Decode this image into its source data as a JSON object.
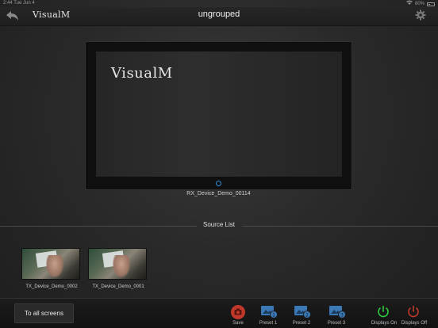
{
  "status_bar": {
    "time": "2:44",
    "date": "Tue Jun 4",
    "battery": "80%"
  },
  "header": {
    "logo": "VisualM",
    "title": "ungrouped"
  },
  "monitor": {
    "screen_logo": "VisualM",
    "label": "RX_Device_Demo_00114",
    "power_color": "#2a8fd6"
  },
  "source_list": {
    "title": "Source List",
    "items": [
      {
        "label": "TX_Device_Demo_0002"
      },
      {
        "label": "TX_Device_Demo_0001"
      }
    ]
  },
  "toolbar": {
    "all_screens_label": "To all screens",
    "save_label": "Save",
    "preset1_label": "Preset 1",
    "preset2_label": "Preset 2",
    "preset3_label": "Preset 3",
    "displays_on_label": "Displays On",
    "displays_off_label": "Displays Off",
    "colors": {
      "save": "#c0392b",
      "preset": "#3a79b5",
      "on": "#2ecc40",
      "off": "#c0392b"
    }
  }
}
